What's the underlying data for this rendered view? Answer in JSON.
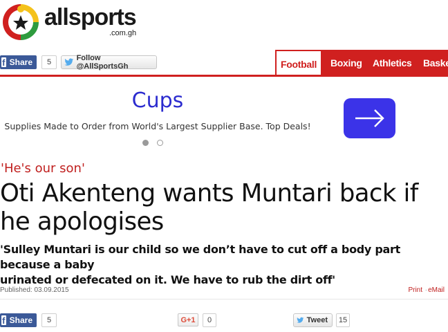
{
  "brand": {
    "name": "allsports",
    "domain": ".com.gh",
    "colors": {
      "red": "#d0201f",
      "yellow": "#f4c21b",
      "green": "#2e9b3e",
      "black": "#1a1a1a"
    }
  },
  "social_top": {
    "facebook_label": "Share",
    "facebook_count": "5",
    "twitter_follow_label": "Follow @AllSportsGh"
  },
  "nav": {
    "items": [
      {
        "label": "Football",
        "active": true
      },
      {
        "label": "Boxing",
        "active": false
      },
      {
        "label": "Athletics",
        "active": false
      },
      {
        "label": "Baske",
        "active": false
      }
    ],
    "color": "#d0201f"
  },
  "ad": {
    "title": "Cups",
    "description": "Supplies Made to Order from World's Largest Supplier Base. Top Deals!",
    "cta_icon": "arrow-right-icon",
    "cta_color": "#3b33e8",
    "slides_total": 2,
    "slide_active": 1
  },
  "article": {
    "kicker": "'He's our son'",
    "headline_line1": "Oti Akenteng wants Muntari back if",
    "headline_line2": "he apologises",
    "standfirst_line1": "'Sulley Muntari is our child so we don’t have to cut off a body part because a baby",
    "standfirst_line2": "urinated or defecated on it. We have to rub the dirt off'",
    "published": "Published: 03.09.2015",
    "print_label": "Print",
    "separator": "·",
    "email_label": "eMail"
  },
  "social_bottom": {
    "facebook_label": "Share",
    "facebook_count": "5",
    "gplus_label": "G+1",
    "gplus_count": "0",
    "tweet_label": "Tweet",
    "tweet_count": "15"
  }
}
